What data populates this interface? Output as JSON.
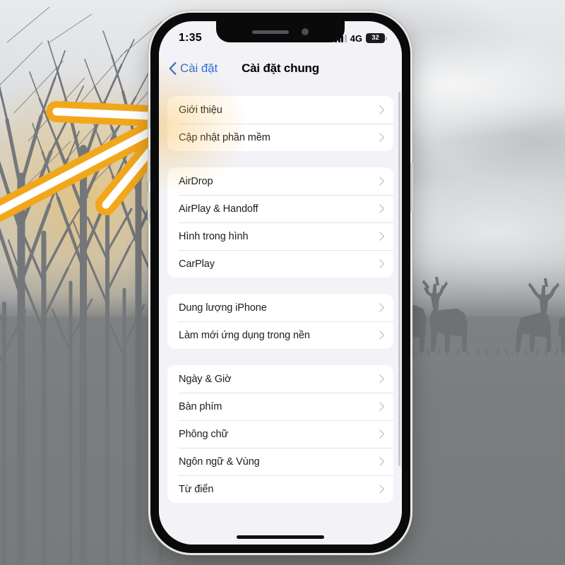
{
  "background": {
    "description": "winter-forest-and-deer-photo",
    "sky_color": "#cfd2d4",
    "ground_color": "#7a7d7f",
    "tree_color": "#6f7275",
    "deer_color": "#6f7275"
  },
  "annotation": {
    "arrow_name": "orange-arrow-pointing-to-gioi-thieu",
    "outline_color": "#F2A71B",
    "core_color": "#FFFFFF"
  },
  "phone": {
    "frame_color": "#0a0a0a",
    "screen_bg": "#f2f2f7"
  },
  "status_bar": {
    "time": "1:35",
    "network": "4G",
    "battery_percent": "32",
    "signal_bars": 4
  },
  "nav": {
    "back_label": "Cài đặt",
    "title": "Cài đặt chung",
    "accent_color": "#2f6fd0"
  },
  "groups": [
    {
      "name": "about-and-software-update",
      "rows": [
        {
          "label": "Giới thiệu"
        },
        {
          "label": "Cập nhật phần mềm"
        }
      ]
    },
    {
      "name": "sharing-and-connectivity",
      "rows": [
        {
          "label": "AirDrop"
        },
        {
          "label": "AirPlay & Handoff"
        },
        {
          "label": "Hình trong hình"
        },
        {
          "label": "CarPlay"
        }
      ]
    },
    {
      "name": "storage-and-background-refresh",
      "rows": [
        {
          "label": "Dung lượng iPhone"
        },
        {
          "label": "Làm mới ứng dụng trong nền"
        }
      ]
    },
    {
      "name": "locale-and-input",
      "rows": [
        {
          "label": "Ngày & Giờ"
        },
        {
          "label": "Bàn phím"
        },
        {
          "label": "Phông chữ"
        },
        {
          "label": "Ngôn ngữ & Vùng"
        },
        {
          "label": "Từ điển"
        }
      ]
    }
  ]
}
